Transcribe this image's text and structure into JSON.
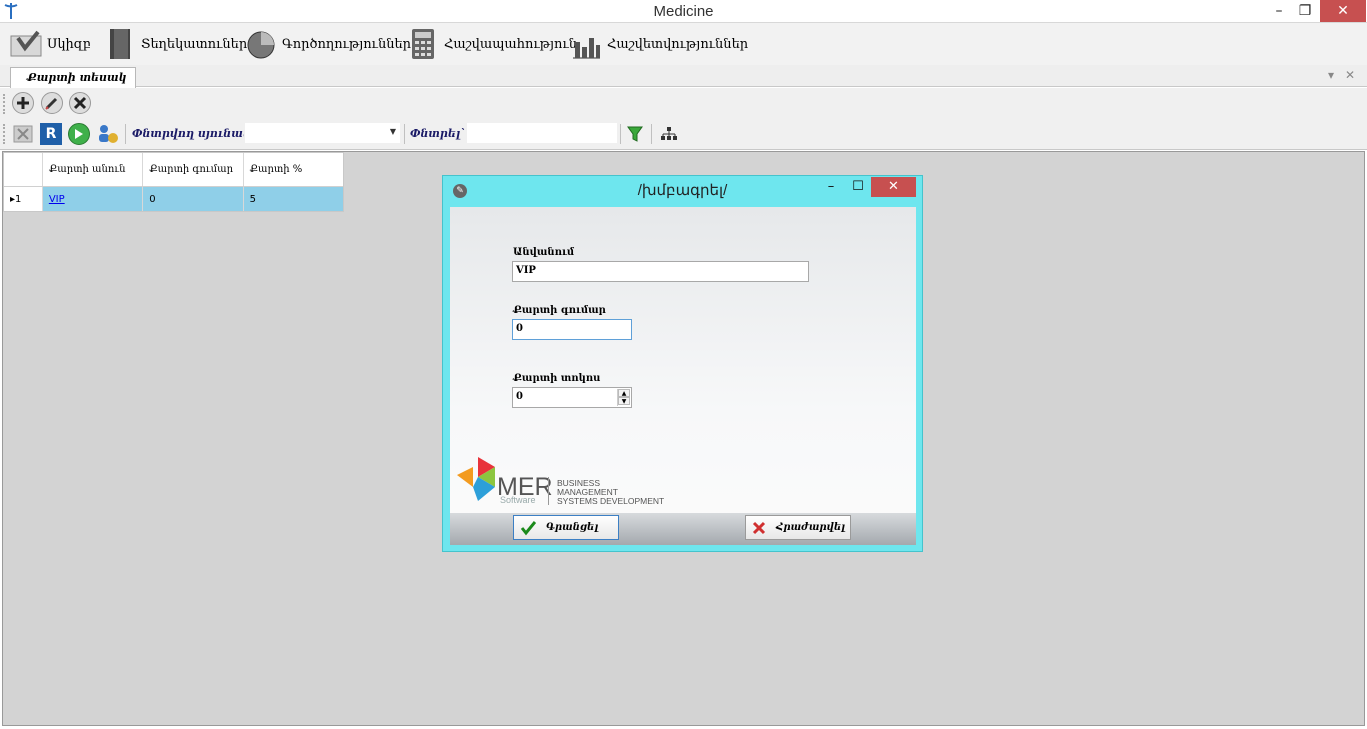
{
  "window": {
    "title": "Medicine",
    "minimize": "–",
    "restore": "❐",
    "close": "✕"
  },
  "menu": {
    "items": [
      {
        "label": "Սկիզբ"
      },
      {
        "label": "Տեղեկատուներ"
      },
      {
        "label": "Գործողություններ"
      },
      {
        "label": "Հաշվապահություն"
      },
      {
        "label": "Հաշվետվություններ"
      }
    ]
  },
  "doc_tab": {
    "label": "Քարտի տեսակ",
    "pin": "▾",
    "close": "✕"
  },
  "toolbar": {
    "filter_column_label": "Փնտրվող սյունակ`",
    "filter_column_value": "",
    "search_label": "Փնտրել`",
    "search_value": ""
  },
  "grid": {
    "columns": [
      "",
      "Քարտի անուն",
      "Քարտի գումար",
      "Քարտի %"
    ],
    "rows": [
      {
        "indicator": "▸1",
        "name": "VIP",
        "amount": "0",
        "percent": "5"
      }
    ]
  },
  "dialog": {
    "title": "/խմբագրել/",
    "icon": "✎",
    "minimize": "–",
    "maximize": "☐",
    "close": "✕",
    "fields": {
      "name_label": "Անվանում",
      "name_value": "VIP",
      "amount_label": "Քարտի գումար",
      "amount_value": "0",
      "discount_label": "Քարտի տոկոս",
      "discount_value": "0"
    },
    "logo": {
      "brand": "MER",
      "sub": "Software",
      "line1": "BUSINESS",
      "line2": "MANAGEMENT",
      "line3": "SYSTEMS DEVELOPMENT"
    },
    "save_label": "Գրանցել",
    "cancel_label": "Հրաժարվել"
  },
  "colors": {
    "dialog_frame": "#6ee6ee",
    "close_red": "#c75050",
    "selected_row": "#8fcfe8",
    "workspace": "#d3d3d3"
  }
}
